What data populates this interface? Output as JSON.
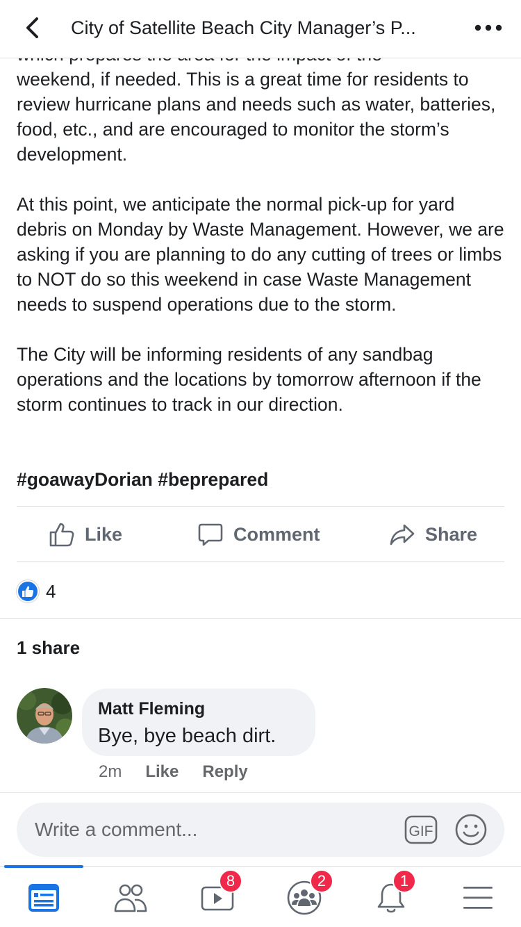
{
  "header": {
    "title": "City of Satellite Beach City Manager’s P...",
    "back_icon": "chevron-left-icon",
    "more_icon": "more-dots-icon"
  },
  "post": {
    "partial_line": "which prepares the area for the impact of the",
    "paragraph1": "weekend, if needed.  This is a great time for residents to review hurricane plans and needs such as water, batteries, food, etc., and are encouraged to monitor the storm’s development.",
    "paragraph2": "At this point, we anticipate the normal pick-up for yard debris on Monday by Waste Management.  However, we are asking if you are planning to do any cutting of trees or limbs to NOT do so this weekend in case Waste Management needs to suspend operations due to the storm.",
    "paragraph3": "The City will be informing residents of any sandbag operations and the locations by tomorrow afternoon if the storm continues to track in our direction.",
    "hashtags": "#goawayDorian #beprepared"
  },
  "actions": {
    "like": "Like",
    "comment": "Comment",
    "share": "Share"
  },
  "reactions": {
    "count": "4",
    "icon": "like-reaction-icon"
  },
  "shares_text": "1 share",
  "comment": {
    "author": "Matt Fleming",
    "text": "Bye, bye beach dirt.",
    "time": "2m",
    "like": "Like",
    "reply": "Reply"
  },
  "composer": {
    "placeholder": "Write a comment...",
    "gif_label": "GIF"
  },
  "tabs": [
    {
      "icon": "news-feed-icon",
      "active": true,
      "badge": ""
    },
    {
      "icon": "friends-icon",
      "active": false,
      "badge": ""
    },
    {
      "icon": "watch-icon",
      "active": false,
      "badge": "8"
    },
    {
      "icon": "groups-icon",
      "active": false,
      "badge": "2"
    },
    {
      "icon": "notifications-bell-icon",
      "active": false,
      "badge": "1"
    },
    {
      "icon": "menu-icon",
      "active": false,
      "badge": ""
    }
  ],
  "colors": {
    "accent": "#1b74e4",
    "badge": "#f02849",
    "muted_text": "#65676b",
    "bubble_bg": "#f0f2f5"
  }
}
